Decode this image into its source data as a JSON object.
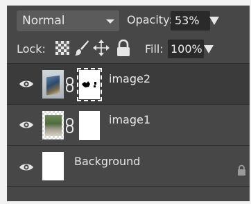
{
  "blend": {
    "mode": "Normal"
  },
  "opacity": {
    "label": "Opacity:",
    "value": "53%"
  },
  "lock": {
    "label": "Lock:"
  },
  "fill": {
    "label": "Fill:",
    "value": "100%"
  },
  "layers": [
    {
      "name": "image2",
      "selected": true,
      "has_mask": true
    },
    {
      "name": "image1",
      "selected": false,
      "has_mask": true
    },
    {
      "name": "Background",
      "selected": false,
      "locked": true
    }
  ],
  "icons": {
    "eye": "eye-icon",
    "chain": "link-chain-icon",
    "lock_transparency": "checkerboard-lock-icon",
    "lock_image": "brush-icon",
    "lock_position": "move-arrows-icon",
    "lock_all": "padlock-icon"
  },
  "colors": {
    "panel": "#474747",
    "selected_row": "#3b3b3b",
    "text": "#e6e6e6",
    "input_bg": "#2a2a2a"
  }
}
